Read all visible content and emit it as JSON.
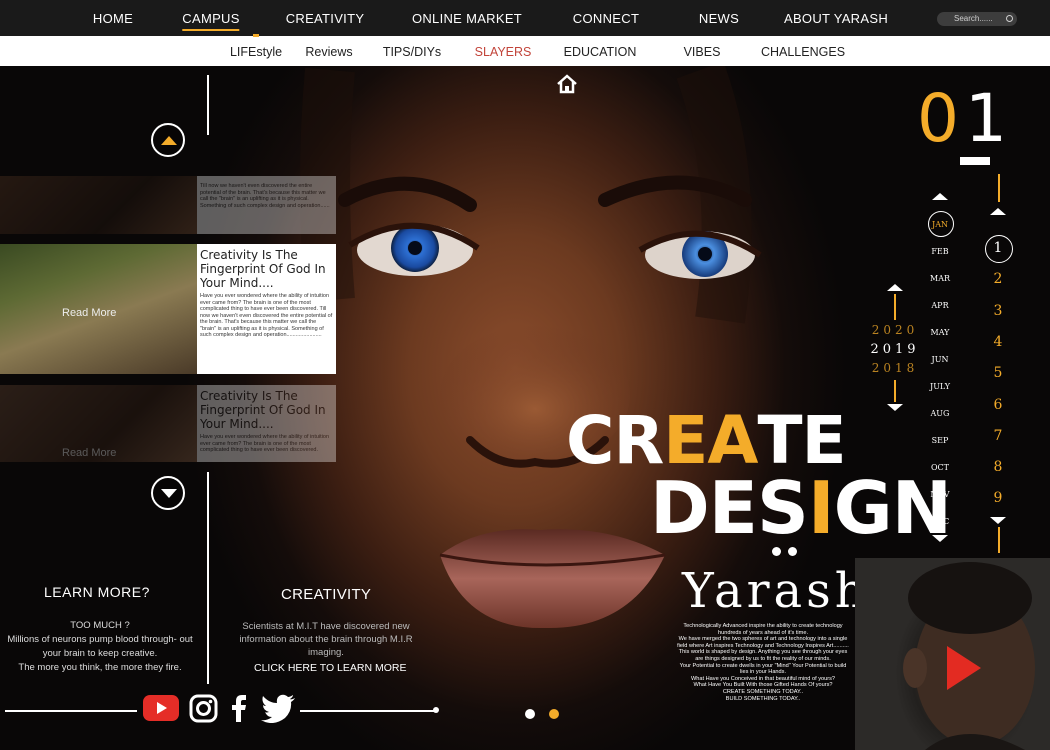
{
  "nav": {
    "items": [
      "HOME",
      "CAMPUS",
      "CREATIVITY",
      "ONLINE MARKET",
      "CONNECT",
      "NEWS",
      "ABOUT YARASH"
    ],
    "active": "CAMPUS",
    "search_placeholder": "Search......"
  },
  "subnav": {
    "items": [
      "LIFEstyle",
      "Reviews",
      "TIPS/DIYs",
      "SLAYERS",
      "EDUCATION",
      "VIBES",
      "CHALLENGES"
    ],
    "active": "SLAYERS"
  },
  "cards": [
    {
      "title": "",
      "read_more": "",
      "body": "Till now we haven't even discovered the entire potential of the brain. That's because this matter we call the \"brain\" is an uplifting as it is physical.\nSomething of such complex design and operation......"
    },
    {
      "title": "Creativity Is The Fingerprint Of God In Your Mind....",
      "read_more": "Read More",
      "body": "Have you ever wondered where the ability of intuition ever came from?\nThe brain is one of the most complicated thing to have ever been discovered.\nTill now we haven't even discovered the entire potential of the brain. That's because this matter we call the \"brain\" is an uplifting as it is physical.\nSomething of such complex design and operation......................."
    },
    {
      "title": "Creativity Is The Fingerprint Of God In Your Mind....",
      "read_more": "Read More",
      "body": "Have you ever wondered where the ability of intuition ever came from?\nThe brain is one of the most complicated thing to have ever been discovered."
    }
  ],
  "learn_more": {
    "heading": "LEARN MORE?",
    "body": "TOO MUCH ?\nMillions of neurons pump blood through- out your brain to keep creative.\nThe more you think, the more they fire."
  },
  "creativity": {
    "heading": "CREATIVITY",
    "body": "Scientists at M.I.T have discovered new information about the brain through M.I.R imaging.",
    "link": "CLICK HERE TO LEARN MORE"
  },
  "social": {
    "icons": [
      "youtube-icon",
      "instagram-icon",
      "facebook-icon",
      "twitter-icon"
    ],
    "youtube_color": "#e52d27"
  },
  "hero": {
    "line1": "CREATE",
    "line2": "DESIGN",
    "signature": "Yarash'",
    "blurb": "Technologically Advanced inspire the ability to create technology hundreds of years ahead of it's time.\nWe have merged the two spheres of art and technology into a single field where Art inspires Technology and Technology Inspires Art..........\nThis world is shaped by design. Anything you see through your eyes are things designed by us to fit the reality of our minds.\nYour Potential to create dwells in your \"Mind\" Your Potential to build lies in your Hands.\nWhat Have you Conceived in that beautiful mind of yours?\nWhat Have You Built With those Gifted Hands Of yours?\nCREATE SOMETHING TODAY..\nBUILD SOMETHING TODAY..",
    "accent": "#f4ac2a"
  },
  "calendar": {
    "number_prefix": "0",
    "number_suffix": "1",
    "months": [
      "JAN",
      "FEB",
      "MAR",
      "APR",
      "MAY",
      "JUN",
      "JULY",
      "AUG",
      "SEP",
      "OCT",
      "NOV",
      "DEC"
    ],
    "selected_month": "JAN",
    "days": [
      "1",
      "2",
      "3",
      "4",
      "5",
      "6",
      "7",
      "8",
      "9"
    ],
    "selected_day": "1",
    "years": [
      "2020",
      "2019",
      "2018"
    ],
    "selected_year": "2019"
  },
  "slider": {
    "count": 2,
    "active": 1
  }
}
